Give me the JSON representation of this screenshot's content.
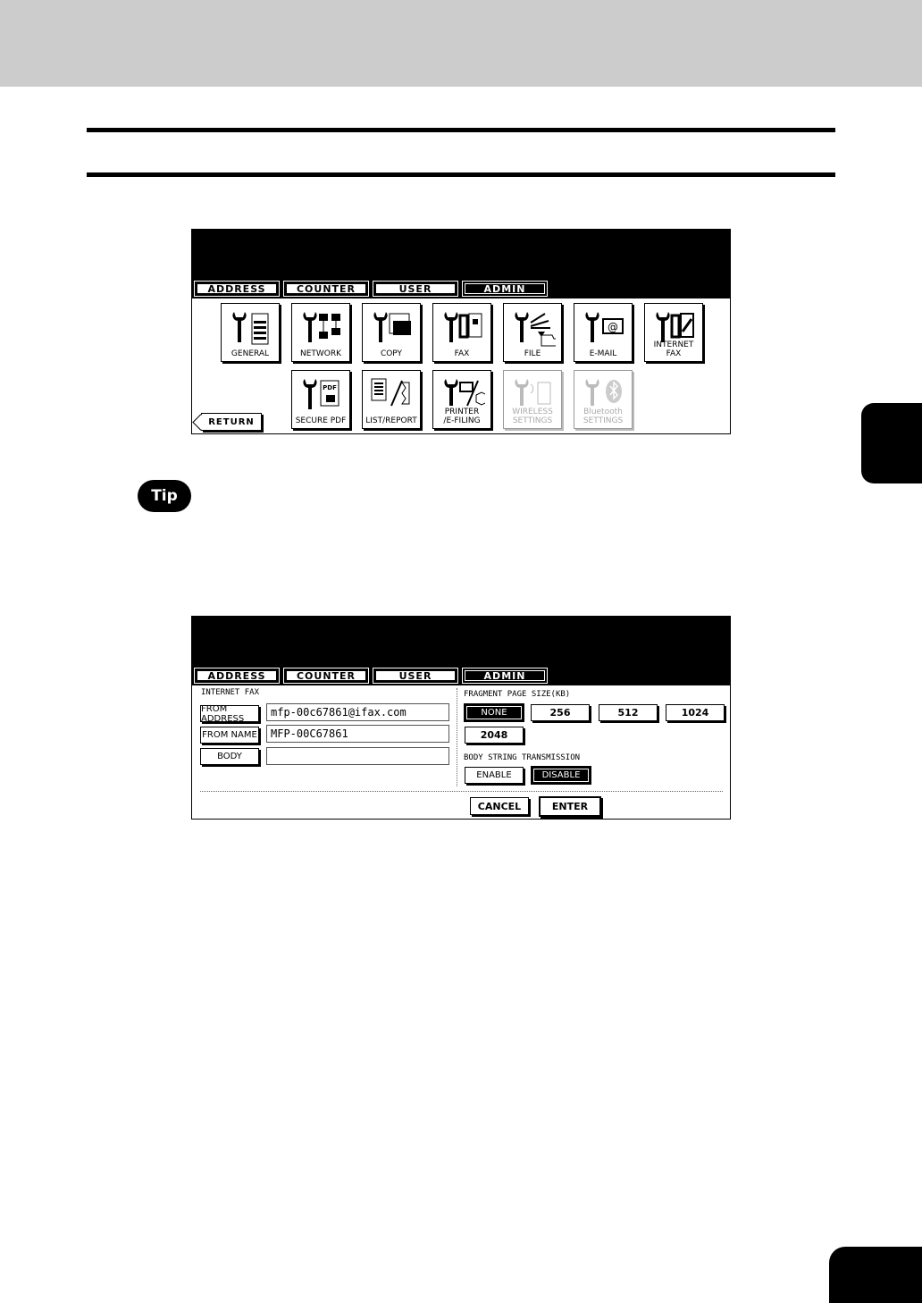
{
  "tip_label": "Tip",
  "screen1": {
    "tabs": [
      "ADDRESS",
      "COUNTER",
      "USER",
      "ADMIN"
    ],
    "icons_row1": [
      {
        "label": "GENERAL",
        "icon": "general-icon"
      },
      {
        "label": "NETWORK",
        "icon": "network-icon"
      },
      {
        "label": "COPY",
        "icon": "copy-icon"
      },
      {
        "label": "FAX",
        "icon": "fax-icon"
      },
      {
        "label": "FILE",
        "icon": "file-icon"
      },
      {
        "label": "E-MAIL",
        "icon": "email-icon"
      },
      {
        "label": "INTERNET FAX",
        "icon": "internet-fax-icon"
      }
    ],
    "icons_row2": [
      {
        "label": "SECURE PDF",
        "icon": "secure-pdf-icon"
      },
      {
        "label": "LIST/REPORT",
        "icon": "list-report-icon"
      },
      {
        "label_line1": "PRINTER",
        "label_line2": "/E-FILING",
        "icon": "printer-efiling-icon"
      },
      {
        "label_line1": "WIRELESS",
        "label_line2": "SETTINGS",
        "icon": "wireless-settings-icon",
        "disabled": true
      },
      {
        "label_line1": "Bluetooth",
        "label_line2": "SETTINGS",
        "icon": "bluetooth-settings-icon",
        "disabled": true
      }
    ],
    "return_label": "RETURN"
  },
  "screen2": {
    "tabs": [
      "ADDRESS",
      "COUNTER",
      "USER",
      "ADMIN"
    ],
    "section_title": "INTERNET FAX",
    "from_address_label": "FROM ADDRESS",
    "from_address_value": "mfp-00c67861@ifax.com",
    "from_name_label": "FROM NAME",
    "from_name_value": "MFP-00C67861",
    "body_label": "BODY",
    "body_value": "",
    "fragment_title": "FRAGMENT PAGE SIZE(KB)",
    "fragment_options": [
      "NONE",
      "256",
      "512",
      "1024",
      "2048"
    ],
    "fragment_selected": "NONE",
    "body_string_title": "BODY STRING TRANSMISSION",
    "enable_label": "ENABLE",
    "disable_label": "DISABLE",
    "body_string_selected": "DISABLE",
    "cancel_label": "CANCEL",
    "enter_label": "ENTER"
  }
}
